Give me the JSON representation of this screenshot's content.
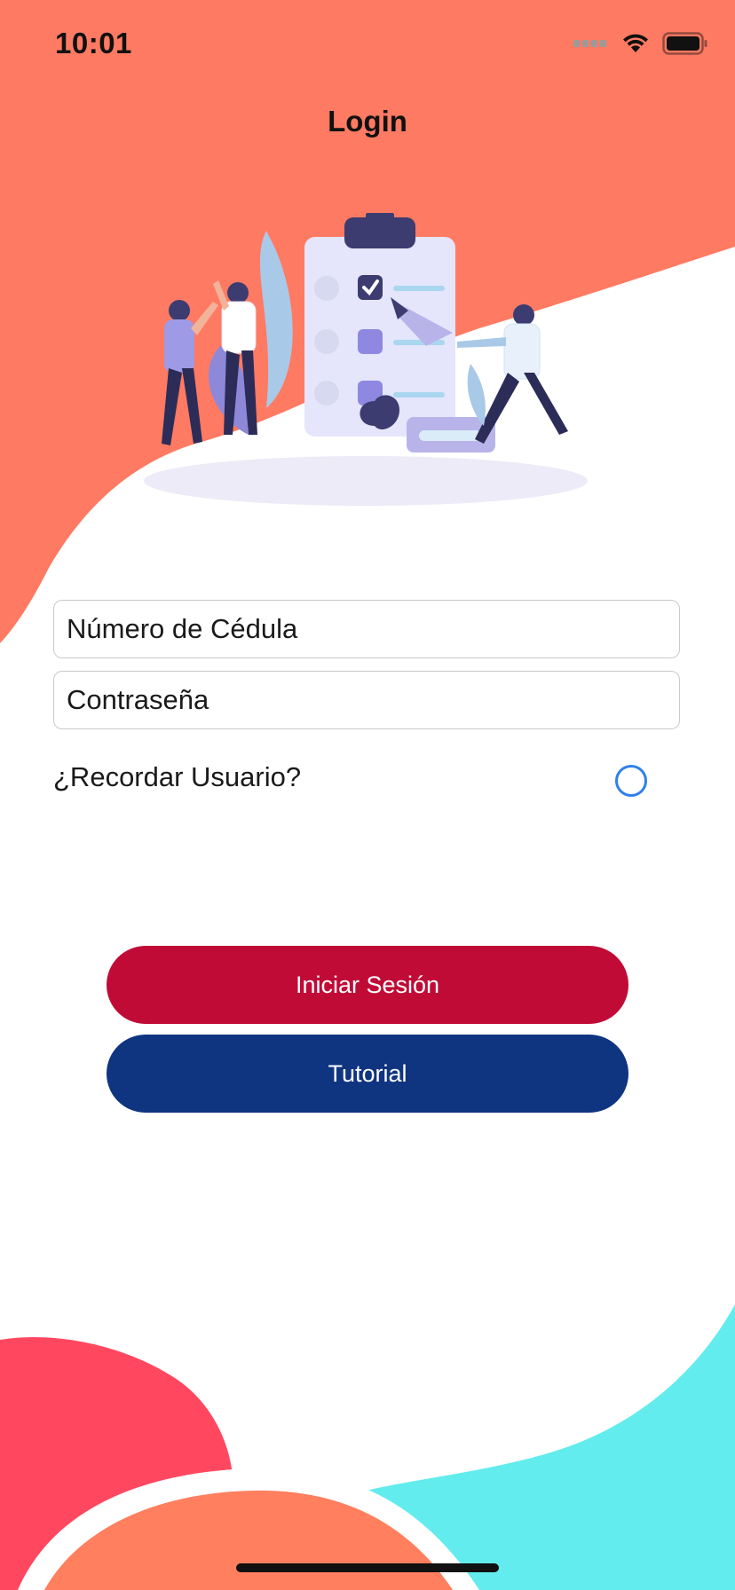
{
  "status_bar": {
    "time": "10:01",
    "icons": [
      "signal-icon",
      "wifi-icon",
      "battery-icon"
    ]
  },
  "nav": {
    "title": "Login"
  },
  "form": {
    "cedula_placeholder": "Número de Cédula",
    "password_placeholder": "Contraseña",
    "remember_label": "¿Recordar Usuario?",
    "remember_checked": false
  },
  "buttons": {
    "login_label": "Iniciar Sesión",
    "tutorial_label": "Tutorial"
  },
  "colors": {
    "top_blob": "#ff7a62",
    "login_button": "#c00b37",
    "tutorial_button": "#0f3480",
    "radio_accent": "#2f80ed",
    "bottom_red_blob": "#ff4860",
    "bottom_orange_blob": "#ff7f5e",
    "bottom_cyan_blob": "#62eced"
  }
}
